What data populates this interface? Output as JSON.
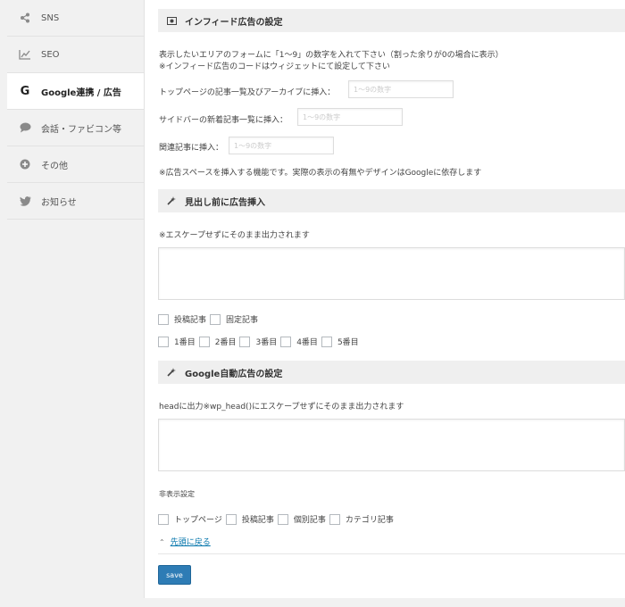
{
  "sidebar": {
    "items": [
      {
        "label": "SNS",
        "icon": "share-icon"
      },
      {
        "label": "SEO",
        "icon": "chart-icon"
      },
      {
        "label": "Google連携 / 広告",
        "icon": "google-icon"
      },
      {
        "label": "会話・ファビコン等",
        "icon": "chat-bubble-icon"
      },
      {
        "label": "その他",
        "icon": "plus-circle-icon"
      },
      {
        "label": "お知らせ",
        "icon": "twitter-bird-icon"
      }
    ]
  },
  "infeed": {
    "title": "インフィード広告の設定",
    "desc1": "表示したいエリアのフォームに「1〜9」の数字を入れて下さい（割った余りが0の場合に表示）",
    "desc2": "※インフィード広告のコードはウィジェットにて設定して下さい",
    "top_label": "トップページの記事一覧及びアーカイブに挿入：",
    "top_placeholder": "1〜9の数字",
    "sidebar_label": "サイドバーの新着記事一覧に挿入：",
    "sidebar_placeholder": "1〜9の数字",
    "related_label": "関連記事に挿入：",
    "related_placeholder": "1〜9の数字",
    "note": "※広告スペースを挿入する機能です。実際の表示の有無やデザインはGoogleに依存します"
  },
  "heading_ad": {
    "title": "見出し前に広告挿入",
    "note": "※エスケープせずにそのまま出力されます",
    "post_types": [
      "投稿記事",
      "固定記事"
    ],
    "positions": [
      "1番目",
      "2番目",
      "3番目",
      "4番目",
      "5番目"
    ]
  },
  "auto_ad": {
    "title": "Google自動広告の設定",
    "note": "headに出力※wp_head()にエスケープせずにそのまま出力されます",
    "hide_label": "非表示設定",
    "hide_options": [
      "トップページ",
      "投稿記事",
      "個別記事",
      "カテゴリ記事"
    ]
  },
  "back_to_top": "先頭に戻る",
  "save_label": "save",
  "colors": {
    "accent": "#2e7cb5",
    "link": "#0073aa",
    "section_bg": "#efefef"
  }
}
